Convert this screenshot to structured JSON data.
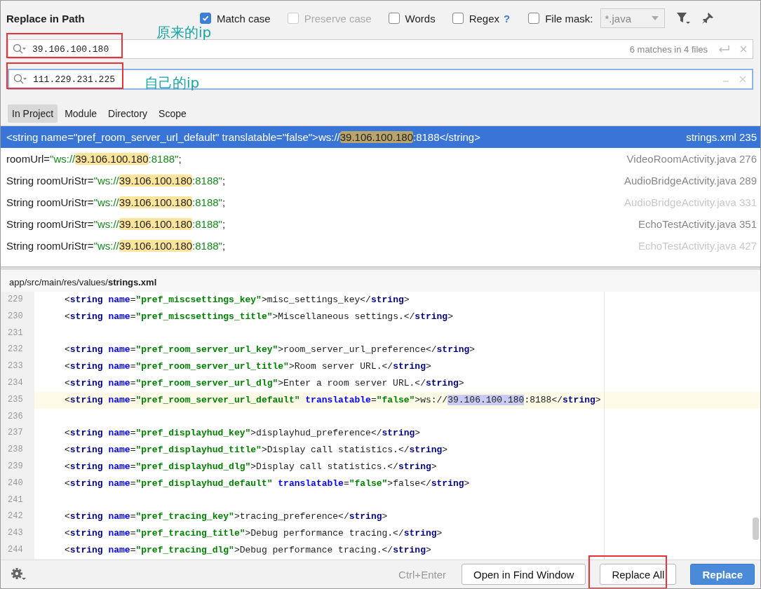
{
  "dialog": {
    "title": "Replace in Path"
  },
  "options": [
    {
      "label": "Match case",
      "checked": true,
      "disabled": false
    },
    {
      "label": "Preserve case",
      "checked": false,
      "disabled": true
    },
    {
      "label": "Words",
      "checked": false,
      "disabled": false
    },
    {
      "label": "Regex",
      "checked": false,
      "disabled": false,
      "help": "?"
    },
    {
      "label": "File mask:",
      "checked": false,
      "disabled": false
    }
  ],
  "file_mask": {
    "value": "*.java",
    "disabled": true
  },
  "search_field": {
    "value": "39.106.100.180",
    "info": "6 matches in 4 files",
    "annotated": true,
    "focused": false
  },
  "replace_field": {
    "value": "111.229.231.225",
    "annotated": true,
    "focused": true
  },
  "annotations": [
    "原来的ip",
    "自己的ip"
  ],
  "scope_tabs": [
    {
      "label": "In Project",
      "selected": true
    },
    {
      "label": "Module",
      "selected": false
    },
    {
      "label": "Directory",
      "selected": false
    },
    {
      "label": "Scope",
      "selected": false
    }
  ],
  "results": [
    {
      "selected": true,
      "dimmed": false,
      "file": "strings.xml 235",
      "preview": [
        {
          "kind": "code",
          "text": "<string name=\"pref_room_server_url_default\" translatable=\"false\">ws://"
        },
        {
          "kind": "match",
          "text": "39.106.100.180"
        },
        {
          "kind": "code",
          "text": ":8188</string>"
        }
      ]
    },
    {
      "selected": false,
      "dimmed": false,
      "file": "VideoRoomActivity.java 276",
      "preview": [
        {
          "kind": "code",
          "text": "roomUrl="
        },
        {
          "kind": "str",
          "text": "\"ws://"
        },
        {
          "kind": "match",
          "text": "39.106.100.180"
        },
        {
          "kind": "str",
          "text": ":8188\""
        },
        {
          "kind": "code",
          "text": ";"
        }
      ]
    },
    {
      "selected": false,
      "dimmed": false,
      "file": "AudioBridgeActivity.java 289",
      "preview": [
        {
          "kind": "code",
          "text": "String roomUriStr="
        },
        {
          "kind": "str",
          "text": "\"ws://"
        },
        {
          "kind": "match",
          "text": "39.106.100.180"
        },
        {
          "kind": "str",
          "text": ":8188\""
        },
        {
          "kind": "code",
          "text": ";"
        }
      ]
    },
    {
      "selected": false,
      "dimmed": true,
      "file": "AudioBridgeActivity.java 331",
      "preview": [
        {
          "kind": "code",
          "text": "String roomUriStr="
        },
        {
          "kind": "str",
          "text": "\"ws://"
        },
        {
          "kind": "match",
          "text": "39.106.100.180"
        },
        {
          "kind": "str",
          "text": ":8188\""
        },
        {
          "kind": "code",
          "text": ";"
        }
      ]
    },
    {
      "selected": false,
      "dimmed": false,
      "file": "EchoTestActivity.java 351",
      "preview": [
        {
          "kind": "code",
          "text": "String roomUriStr="
        },
        {
          "kind": "str",
          "text": "\"ws://"
        },
        {
          "kind": "match",
          "text": "39.106.100.180"
        },
        {
          "kind": "str",
          "text": ":8188\""
        },
        {
          "kind": "code",
          "text": ";"
        }
      ]
    },
    {
      "selected": false,
      "dimmed": true,
      "file": "EchoTestActivity.java 427",
      "preview": [
        {
          "kind": "code",
          "text": "String roomUriStr="
        },
        {
          "kind": "str",
          "text": "\"ws://"
        },
        {
          "kind": "match",
          "text": "39.106.100.180"
        },
        {
          "kind": "str",
          "text": ":8188\""
        },
        {
          "kind": "code",
          "text": ";"
        }
      ]
    }
  ],
  "preview_path": {
    "dir": "app/src/main/res/values/",
    "file": "strings.xml"
  },
  "code_lines": [
    {
      "number": "229",
      "current": false,
      "tokens": [
        {
          "kind": "p",
          "text": "<"
        },
        {
          "kind": "tag",
          "text": "string"
        },
        {
          "kind": "attr",
          "text": " name"
        },
        {
          "kind": "p",
          "text": "="
        },
        {
          "kind": "val",
          "text": "\"pref_miscsettings_key\""
        },
        {
          "kind": "p",
          "text": ">misc_settings_key</"
        },
        {
          "kind": "tag",
          "text": "string"
        },
        {
          "kind": "p",
          "text": ">"
        }
      ]
    },
    {
      "number": "230",
      "current": false,
      "tokens": [
        {
          "kind": "p",
          "text": "<"
        },
        {
          "kind": "tag",
          "text": "string"
        },
        {
          "kind": "attr",
          "text": " name"
        },
        {
          "kind": "p",
          "text": "="
        },
        {
          "kind": "val",
          "text": "\"pref_miscsettings_title\""
        },
        {
          "kind": "p",
          "text": ">Miscellaneous settings.</"
        },
        {
          "kind": "tag",
          "text": "string"
        },
        {
          "kind": "p",
          "text": ">"
        }
      ]
    },
    {
      "number": "231",
      "current": false
    },
    {
      "number": "232",
      "current": false,
      "tokens": [
        {
          "kind": "p",
          "text": "<"
        },
        {
          "kind": "tag",
          "text": "string"
        },
        {
          "kind": "attr",
          "text": " name"
        },
        {
          "kind": "p",
          "text": "="
        },
        {
          "kind": "val",
          "text": "\"pref_room_server_url_key\""
        },
        {
          "kind": "p",
          "text": ">room_server_url_preference</"
        },
        {
          "kind": "tag",
          "text": "string"
        },
        {
          "kind": "p",
          "text": ">"
        }
      ]
    },
    {
      "number": "233",
      "current": false,
      "tokens": [
        {
          "kind": "p",
          "text": "<"
        },
        {
          "kind": "tag",
          "text": "string"
        },
        {
          "kind": "attr",
          "text": " name"
        },
        {
          "kind": "p",
          "text": "="
        },
        {
          "kind": "val",
          "text": "\"pref_room_server_url_title\""
        },
        {
          "kind": "p",
          "text": ">Room server URL.</"
        },
        {
          "kind": "tag",
          "text": "string"
        },
        {
          "kind": "p",
          "text": ">"
        }
      ]
    },
    {
      "number": "234",
      "current": false,
      "tokens": [
        {
          "kind": "p",
          "text": "<"
        },
        {
          "kind": "tag",
          "text": "string"
        },
        {
          "kind": "attr",
          "text": " name"
        },
        {
          "kind": "p",
          "text": "="
        },
        {
          "kind": "val",
          "text": "\"pref_room_server_url_dlg\""
        },
        {
          "kind": "p",
          "text": ">Enter a room server URL.</"
        },
        {
          "kind": "tag",
          "text": "string"
        },
        {
          "kind": "p",
          "text": ">"
        }
      ]
    },
    {
      "number": "235",
      "current": true,
      "tokens": [
        {
          "kind": "p",
          "text": "<"
        },
        {
          "kind": "tag",
          "text": "string"
        },
        {
          "kind": "attr",
          "text": " name"
        },
        {
          "kind": "p",
          "text": "="
        },
        {
          "kind": "val",
          "text": "\"pref_room_server_url_default\""
        },
        {
          "kind": "attr",
          "text": " translatable"
        },
        {
          "kind": "p",
          "text": "="
        },
        {
          "kind": "val",
          "text": "\"false\""
        },
        {
          "kind": "p",
          "text": ">ws://"
        },
        {
          "kind": "match",
          "text": "39.106.100.180"
        },
        {
          "kind": "p",
          "text": ":8188</"
        },
        {
          "kind": "tag",
          "text": "string"
        },
        {
          "kind": "p",
          "text": ">"
        }
      ]
    },
    {
      "number": "236",
      "current": false
    },
    {
      "number": "237",
      "current": false,
      "tokens": [
        {
          "kind": "p",
          "text": "<"
        },
        {
          "kind": "tag",
          "text": "string"
        },
        {
          "kind": "attr",
          "text": " name"
        },
        {
          "kind": "p",
          "text": "="
        },
        {
          "kind": "val",
          "text": "\"pref_displayhud_key\""
        },
        {
          "kind": "p",
          "text": ">displayhud_preference</"
        },
        {
          "kind": "tag",
          "text": "string"
        },
        {
          "kind": "p",
          "text": ">"
        }
      ]
    },
    {
      "number": "238",
      "current": false,
      "tokens": [
        {
          "kind": "p",
          "text": "<"
        },
        {
          "kind": "tag",
          "text": "string"
        },
        {
          "kind": "attr",
          "text": " name"
        },
        {
          "kind": "p",
          "text": "="
        },
        {
          "kind": "val",
          "text": "\"pref_displayhud_title\""
        },
        {
          "kind": "p",
          "text": ">Display call statistics.</"
        },
        {
          "kind": "tag",
          "text": "string"
        },
        {
          "kind": "p",
          "text": ">"
        }
      ]
    },
    {
      "number": "239",
      "current": false,
      "tokens": [
        {
          "kind": "p",
          "text": "<"
        },
        {
          "kind": "tag",
          "text": "string"
        },
        {
          "kind": "attr",
          "text": " name"
        },
        {
          "kind": "p",
          "text": "="
        },
        {
          "kind": "val",
          "text": "\"pref_displayhud_dlg\""
        },
        {
          "kind": "p",
          "text": ">Display call statistics.</"
        },
        {
          "kind": "tag",
          "text": "string"
        },
        {
          "kind": "p",
          "text": ">"
        }
      ]
    },
    {
      "number": "240",
      "current": false,
      "tokens": [
        {
          "kind": "p",
          "text": "<"
        },
        {
          "kind": "tag",
          "text": "string"
        },
        {
          "kind": "attr",
          "text": " name"
        },
        {
          "kind": "p",
          "text": "="
        },
        {
          "kind": "val",
          "text": "\"pref_displayhud_default\""
        },
        {
          "kind": "attr",
          "text": " translatable"
        },
        {
          "kind": "p",
          "text": "="
        },
        {
          "kind": "val",
          "text": "\"false\""
        },
        {
          "kind": "p",
          "text": ">false</"
        },
        {
          "kind": "tag",
          "text": "string"
        },
        {
          "kind": "p",
          "text": ">"
        }
      ]
    },
    {
      "number": "241",
      "current": false
    },
    {
      "number": "242",
      "current": false,
      "tokens": [
        {
          "kind": "p",
          "text": "<"
        },
        {
          "kind": "tag",
          "text": "string"
        },
        {
          "kind": "attr",
          "text": " name"
        },
        {
          "kind": "p",
          "text": "="
        },
        {
          "kind": "val",
          "text": "\"pref_tracing_key\""
        },
        {
          "kind": "p",
          "text": ">tracing_preference</"
        },
        {
          "kind": "tag",
          "text": "string"
        },
        {
          "kind": "p",
          "text": ">"
        }
      ]
    },
    {
      "number": "243",
      "current": false,
      "tokens": [
        {
          "kind": "p",
          "text": "<"
        },
        {
          "kind": "tag",
          "text": "string"
        },
        {
          "kind": "attr",
          "text": " name"
        },
        {
          "kind": "p",
          "text": "="
        },
        {
          "kind": "val",
          "text": "\"pref_tracing_title\""
        },
        {
          "kind": "p",
          "text": ">Debug performance tracing.</"
        },
        {
          "kind": "tag",
          "text": "string"
        },
        {
          "kind": "p",
          "text": ">"
        }
      ]
    },
    {
      "number": "244",
      "current": false,
      "tokens": [
        {
          "kind": "p",
          "text": "<"
        },
        {
          "kind": "tag",
          "text": "string"
        },
        {
          "kind": "attr",
          "text": " name"
        },
        {
          "kind": "p",
          "text": "="
        },
        {
          "kind": "val",
          "text": "\"pref_tracing_dlg\""
        },
        {
          "kind": "p",
          "text": ">Debug performance tracing.</"
        },
        {
          "kind": "tag",
          "text": "string"
        },
        {
          "kind": "p",
          "text": ">"
        }
      ]
    }
  ],
  "footer": {
    "shortcut": "Ctrl+Enter",
    "buttons": [
      {
        "label": "Open in Find Window",
        "kind": "normal",
        "annotated": false
      },
      {
        "label": "Replace All",
        "kind": "normal",
        "annotated": true
      },
      {
        "label": "Replace",
        "kind": "primary",
        "annotated": false
      }
    ]
  }
}
